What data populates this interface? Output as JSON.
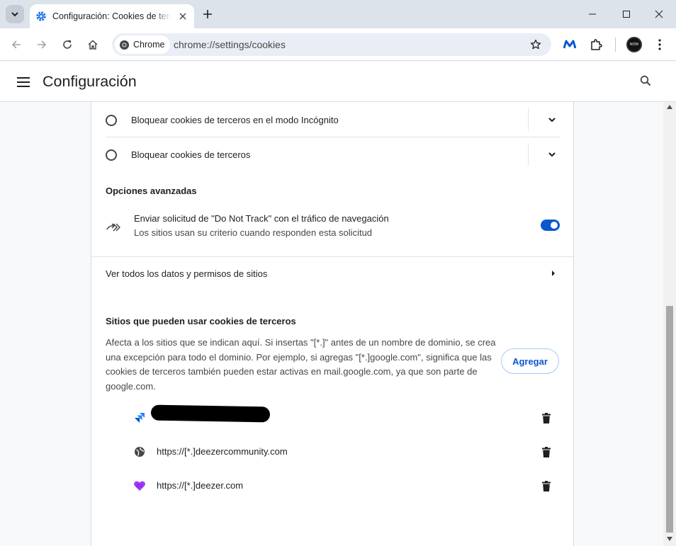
{
  "browser": {
    "tab_title": "Configuración: Cookies de terceros",
    "url": "chrome://settings/cookies",
    "chip_label": "Chrome",
    "avatar_text": "NOW"
  },
  "settings": {
    "page_title": "Configuración",
    "options": [
      {
        "label": "Bloquear cookies de terceros en el modo Incógnito",
        "selected": false
      },
      {
        "label": "Bloquear cookies de terceros",
        "selected": false
      }
    ],
    "advanced_title": "Opciones avanzadas",
    "dnt": {
      "title": "Enviar solicitud de \"Do Not Track\" con el tráfico de navegación",
      "subtitle": "Los sitios usan su criterio cuando responden esta solicitud",
      "enabled": true
    },
    "all_site_data_label": "Ver todos los datos y permisos de sitios",
    "allowed_sites": {
      "title": "Sitios que pueden usar cookies de terceros",
      "description": "Afecta a los sitios que se indican aquí. Si insertas \"[*.]\" antes de un nombre de dominio, se crea una excepción para todo el dominio. Por ejemplo, si agregas \"[*.]google.com\", significa que las cookies de terceros también pueden estar activas en mail.google.com, ya que son parte de google.com.",
      "add_label": "Agregar",
      "sites": [
        {
          "url": "",
          "icon": "jira-icon",
          "redacted": true
        },
        {
          "url": "https://[*.]deezercommunity.com",
          "icon": "globe-icon",
          "redacted": false
        },
        {
          "url": "https://[*.]deezer.com",
          "icon": "deezer-heart-icon",
          "redacted": false
        }
      ]
    }
  },
  "colors": {
    "accent": "#0b57d0",
    "tabstrip": "#dde3ea",
    "omnibox": "#e9eef6"
  }
}
